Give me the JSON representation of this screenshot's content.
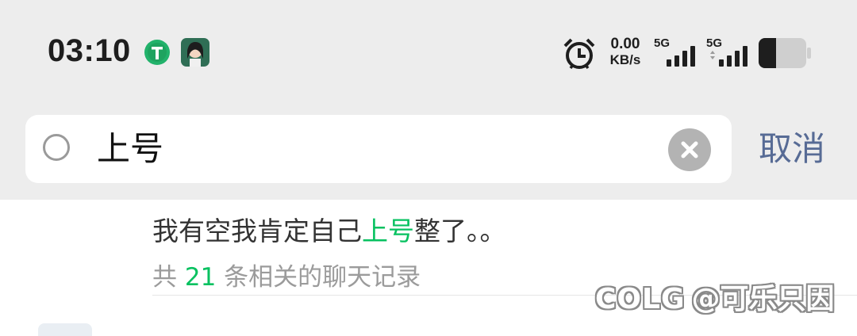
{
  "status_bar": {
    "time": "03:10",
    "network_speed_value": "0.00",
    "network_speed_unit": "KB/s",
    "signal_1_label": "5G",
    "signal_2_label": "5G",
    "icons": [
      "app-t-icon",
      "app-avatar-icon",
      "alarm-icon",
      "signal-icon",
      "signal-icon",
      "battery-icon"
    ]
  },
  "search": {
    "query": "上号",
    "cancel_label": "取消"
  },
  "result": {
    "text_before": "我有空我肯定自己",
    "text_match": "上号",
    "text_after": "整了。。",
    "record_prefix": "共",
    "record_count": "21",
    "record_suffix": "条相关的聊天记录"
  },
  "watermark": {
    "logo": "COLG",
    "text": "@可乐只因"
  },
  "colors": {
    "background_top": "#ededed",
    "highlight": "#07c160",
    "cancel": "#576b95",
    "muted": "#9b9b9b"
  }
}
